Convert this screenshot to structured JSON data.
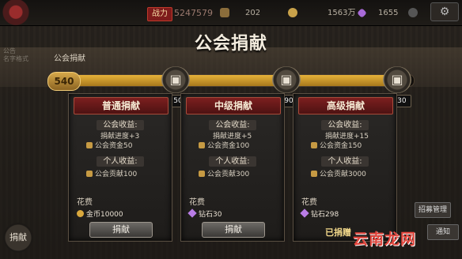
{
  "topbar": {
    "power_label": "战力",
    "power_value": "5247579",
    "resources": [
      {
        "icon": "stamina-icon",
        "value": "202",
        "color": "#8a6d3b"
      },
      {
        "icon": "coin-icon",
        "value": "1563万",
        "color": "#c9a24a"
      },
      {
        "icon": "gem-icon",
        "value": "1655",
        "color": "#a86ad8"
      }
    ]
  },
  "left_overlay": {
    "notice": "公告",
    "name_format": "名字格式"
  },
  "page": {
    "title": "公会捐献",
    "subtitle": "公会捐献"
  },
  "progress": {
    "total": "540",
    "fraction": 0.98,
    "milestones": [
      {
        "value": "50",
        "icon": "chest-icon"
      },
      {
        "value": "90",
        "icon": "chest-icon"
      },
      {
        "value": "130",
        "icon": "chest-icon"
      }
    ]
  },
  "cards": [
    {
      "title": "普通捐献",
      "guild_income_label": "公会收益:",
      "progress_text": "捐献进度+3",
      "fund_text": "公会资金50",
      "personal_income_label": "个人收益:",
      "contribution_text": "公会贡献100",
      "cost_label": "花费",
      "cost_text": "金币10000",
      "cost_icon": "coin-icon",
      "button_label": "捐献"
    },
    {
      "title": "中级捐献",
      "guild_income_label": "公会收益:",
      "progress_text": "捐献进度+5",
      "fund_text": "公会资金100",
      "personal_income_label": "个人收益:",
      "contribution_text": "公会贡献300",
      "cost_label": "花费",
      "cost_text": "钻石30",
      "cost_icon": "gem-icon",
      "button_label": "捐献"
    },
    {
      "title": "高级捐献",
      "guild_income_label": "公会收益:",
      "progress_text": "捐献进度+15",
      "fund_text": "公会资金150",
      "personal_income_label": "个人收益:",
      "contribution_text": "公会贡献3000",
      "cost_label": "花费",
      "cost_text": "钻石298",
      "cost_icon": "gem-icon",
      "donated_text": "已捐赠"
    }
  ],
  "side": {
    "left_button": "捐献",
    "right_top": "招募管理",
    "right_bottom": "通知"
  },
  "watermark": "云南龙网",
  "colors": {
    "accent_red": "#7c1f1f",
    "progress_gold": "#e6b23a"
  }
}
